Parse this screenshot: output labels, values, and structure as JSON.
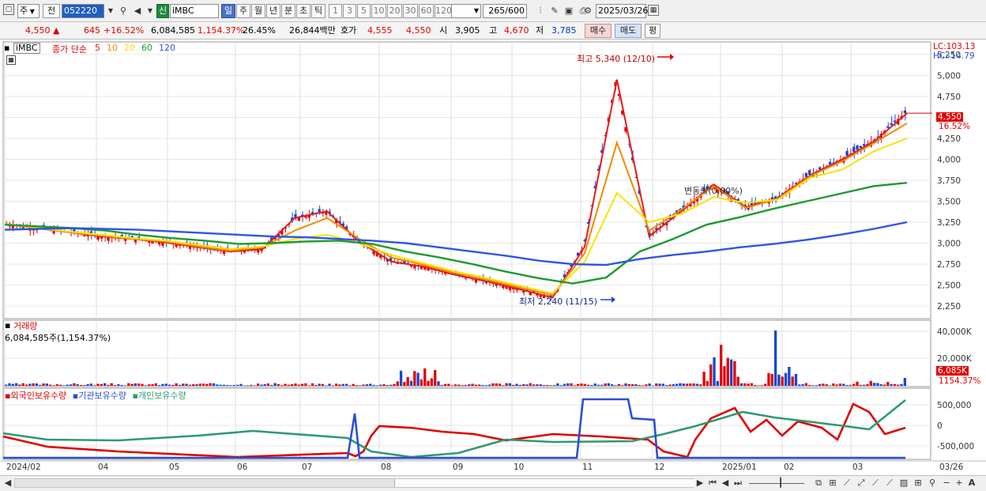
{
  "toolbar": {
    "market": "주",
    "prev_label": "전",
    "code": "052220",
    "name": "iMBC",
    "badge": "신",
    "periods": [
      "일",
      "주",
      "월",
      "년",
      "분",
      "초",
      "틱"
    ],
    "active_period": "일",
    "intervals": [
      "1",
      "3",
      "5",
      "10",
      "20",
      "30",
      "60",
      "120"
    ],
    "count_value": "265",
    "count_total": "/600",
    "date": "2025/03/26"
  },
  "quote": {
    "price": "4,550",
    "change": "645",
    "change_pct": "+16.52%",
    "volume": "6,084,585",
    "volume_pct": "1,154.37%",
    "turnover": "26.45%",
    "amount": "26,844백만",
    "hoga_label": "호가",
    "ask": "4,555",
    "bid": "4,550",
    "open_label": "시",
    "open": "3,905",
    "high_label": "고",
    "high": "4,670",
    "low_label": "저",
    "low": "3,785",
    "buy_btn": "매수",
    "sell_btn": "매도",
    "avg_btn": "평"
  },
  "price_panel": {
    "name": "iMBC",
    "ma_title": "종가 단순",
    "ma": [
      {
        "label": "5",
        "color": "#e51b1b"
      },
      {
        "label": "10",
        "color": "#f08a00"
      },
      {
        "label": "20",
        "color": "#f5e400"
      },
      {
        "label": "60",
        "color": "#1e9a2f"
      },
      {
        "label": "120",
        "color": "#2e55e6"
      }
    ],
    "lc": "LC:103.13",
    "hc": "HC:-14.79",
    "high_note": "최고 5,340 (12/10)",
    "low_note": "최저 2,240 (11/15)",
    "vi_note": "변동락(0.00%)",
    "cur_price": "4,550",
    "cur_pct": "16.52%"
  },
  "chart_data": {
    "type": "line",
    "title": "iMBC",
    "y_ticks": [
      "5,250",
      "5,000",
      "4,750",
      "4,500",
      "4,250",
      "4,000",
      "3,750",
      "3,500",
      "3,250",
      "3,000",
      "2,750",
      "2,500",
      "2,250"
    ],
    "ylim": [
      2100,
      5400
    ],
    "x_labels": [
      "2024/02",
      "04",
      "05",
      "06",
      "07",
      "08",
      "09",
      "10",
      "11",
      "12",
      "2025/01",
      "02",
      "03",
      "03/26"
    ],
    "series": [
      {
        "name": "5",
        "color": "#e51b1b",
        "values": [
          3230,
          3180,
          3130,
          3080,
          3050,
          3010,
          2950,
          2900,
          2930,
          3300,
          3380,
          3020,
          2780,
          2720,
          2620,
          2540,
          2450,
          2350,
          2960,
          4950,
          3080,
          3380,
          3700,
          3430,
          3540,
          3810,
          4000,
          4220,
          4550
        ]
      },
      {
        "name": "10",
        "color": "#f08a00",
        "values": [
          3230,
          3180,
          3130,
          3090,
          3050,
          3020,
          2960,
          2910,
          2950,
          3150,
          3300,
          3050,
          2830,
          2740,
          2640,
          2560,
          2470,
          2380,
          2880,
          4200,
          3150,
          3400,
          3680,
          3420,
          3530,
          3800,
          3980,
          4200,
          4430
        ]
      },
      {
        "name": "20",
        "color": "#f5e400",
        "values": [
          3230,
          3185,
          3140,
          3100,
          3060,
          3030,
          2980,
          2930,
          2960,
          3050,
          3100,
          3000,
          2860,
          2760,
          2660,
          2580,
          2490,
          2400,
          2780,
          3600,
          3250,
          3350,
          3550,
          3480,
          3520,
          3780,
          3880,
          4100,
          4250
        ]
      },
      {
        "name": "60",
        "color": "#1e9a2f",
        "values": [
          3220,
          3200,
          3180,
          3150,
          3100,
          3060,
          3030,
          2990,
          3000,
          3020,
          3030,
          2990,
          2900,
          2830,
          2750,
          2660,
          2580,
          2520,
          2590,
          2900,
          3050,
          3220,
          3310,
          3410,
          3500,
          3590,
          3680,
          3720
        ]
      },
      {
        "name": "120",
        "color": "#2e55e6",
        "values": [
          3160,
          3170,
          3180,
          3170,
          3160,
          3140,
          3120,
          3100,
          3080,
          3070,
          3050,
          3030,
          3000,
          2950,
          2900,
          2850,
          2790,
          2750,
          2740,
          2810,
          2860,
          2900,
          2950,
          2990,
          3040,
          3100,
          3170,
          3250
        ]
      }
    ],
    "volume": {
      "label": "거래량",
      "text": "6,084,585주(1,154.37%)",
      "ticks": [
        "40,000K",
        "20,000K"
      ],
      "cur": "6,085K",
      "cur_pct": "1154.37%"
    },
    "holdings": {
      "series": [
        {
          "name": "외국인보유수량",
          "color": "#e00000"
        },
        {
          "name": "기관보유수량",
          "color": "#2a4fd6"
        },
        {
          "name": "개인보유수량",
          "color": "#2e9a6e"
        }
      ],
      "ticks": [
        "500,000",
        "0",
        "-500,000"
      ]
    }
  },
  "bottom": {
    "zoom_label": "A"
  }
}
